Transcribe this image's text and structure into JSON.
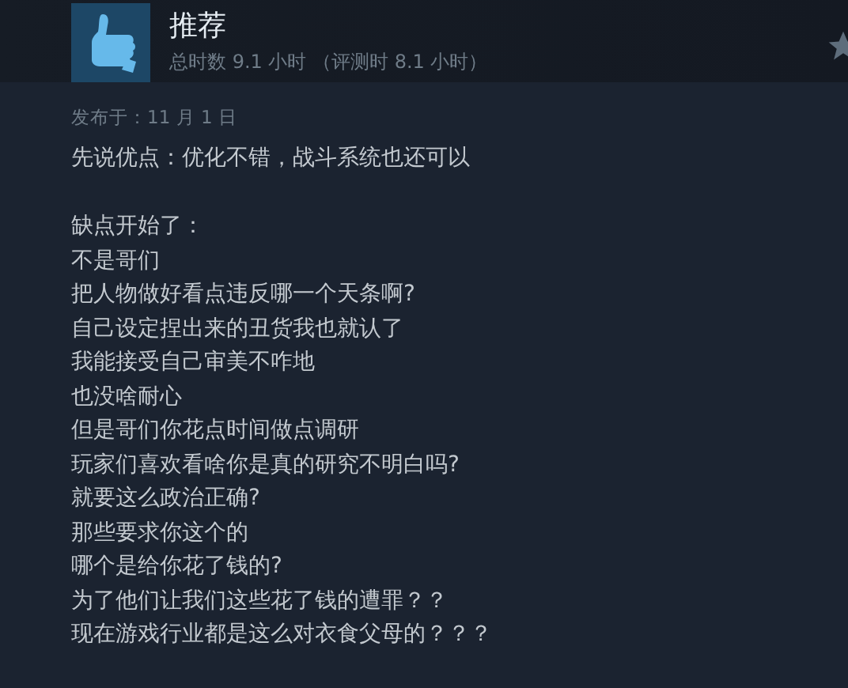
{
  "review": {
    "verdict": "推荐",
    "hours": "总时数 9.1 小时 （评测时 8.1 小时）",
    "posted": "发布于：11 月 1 日",
    "paragraphs": [
      [
        "先说优点：优化不错，战斗系统也还可以"
      ],
      [
        "缺点开始了：",
        "不是哥们",
        "把人物做好看点违反哪一个天条啊?",
        "自己设定捏出来的丑货我也就认了",
        "我能接受自己审美不咋地",
        "也没啥耐心",
        "但是哥们你花点时间做点调研",
        "玩家们喜欢看啥你是真的研究不明白吗?",
        "就要这么政治正确?",
        "那些要求你这个的",
        "哪个是给你花了钱的?",
        "为了他们让我们这些花了钱的遭罪？？",
        "现在游戏行业都是这么对衣食父母的？？？"
      ]
    ]
  }
}
